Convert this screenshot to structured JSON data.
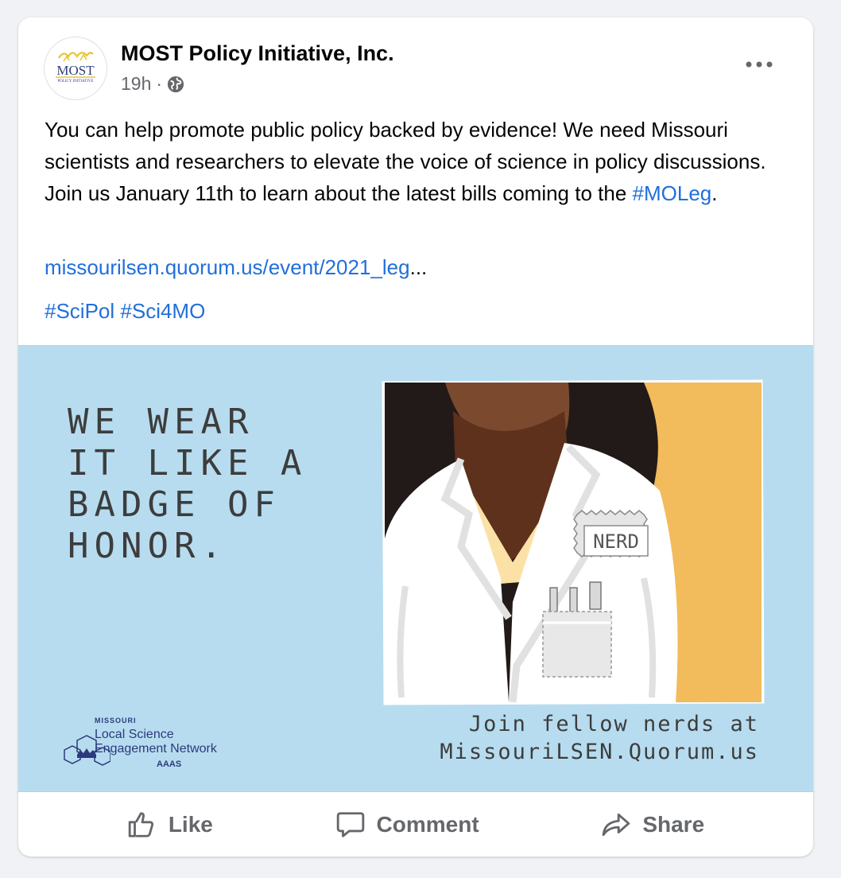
{
  "post": {
    "page_name": "MOST Policy Initiative, Inc.",
    "timestamp": "19h",
    "separator": "·",
    "audience_icon": "globe-icon",
    "avatar_logo": {
      "title": "MOST",
      "subtitle": "POLICY INITIATIVE"
    },
    "text": {
      "body": "You can help promote public policy backed by evidence! We need Missouri scientists and researchers to elevate the voice of science in policy discussions. Join us January 11th to learn about the latest bills coming to the ",
      "hashtag": "#MOLeg",
      "end": "."
    },
    "url_text": "missourilsen.quorum.us/event/2021_leg",
    "url_ellipsis": "...",
    "hashtags": [
      "#SciPol",
      "#Sci4MO"
    ]
  },
  "image": {
    "slogan_lines": [
      "WE WEAR",
      "IT LIKE A",
      "BADGE OF",
      "HONOR."
    ],
    "badge_text": "NERD",
    "join_lines": [
      "Join fellow nerds at",
      "MissouriLSEN.Quorum.us"
    ],
    "logo": {
      "state": "MISSOURI",
      "line1": "Local Science",
      "line2": "Engagement Network",
      "org": "AAAS"
    },
    "colors": {
      "background": "#b7dcef",
      "accent": "#f2bb5c",
      "skin": "#6a3a22"
    }
  },
  "actions": {
    "like": "Like",
    "comment": "Comment",
    "share": "Share"
  }
}
